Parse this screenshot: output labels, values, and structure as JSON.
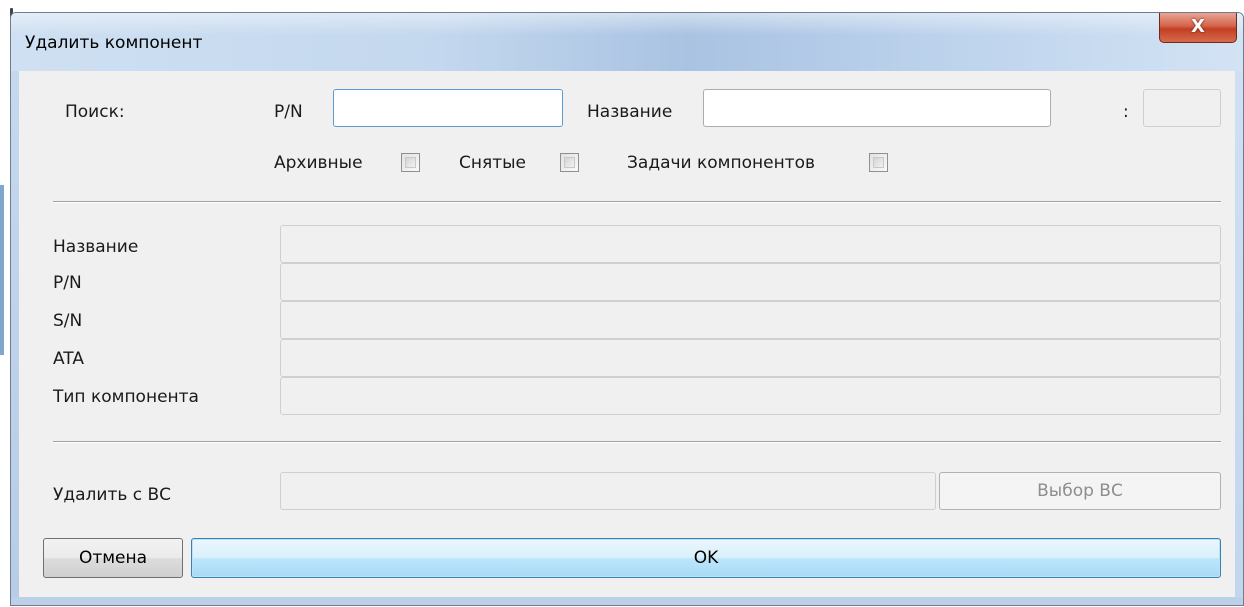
{
  "window": {
    "title": "Удалить компонент",
    "close_label": "X"
  },
  "search": {
    "label": "Поиск:",
    "pn_label": "P/N",
    "pn_value": "",
    "name_label": "Название",
    "name_value": "",
    "colon_label": ":",
    "extra_value": ""
  },
  "filters": {
    "archive_label": "Архивные",
    "archive_checked": false,
    "removed_label": "Снятые",
    "removed_checked": false,
    "tasks_label": "Задачи компонентов",
    "tasks_checked": false
  },
  "details": {
    "name_label": "Название",
    "pn_label": "P/N",
    "sn_label": "S/N",
    "ata_label": "ATA",
    "type_label": "Тип компонента",
    "name_value": "",
    "pn_value": "",
    "sn_value": "",
    "ata_value": "",
    "type_value": ""
  },
  "remove_from": {
    "label": "Удалить с ВС",
    "value": "",
    "select_label": "Выбор ВС"
  },
  "actions": {
    "cancel_label": "Отмена",
    "ok_label": "OK"
  }
}
